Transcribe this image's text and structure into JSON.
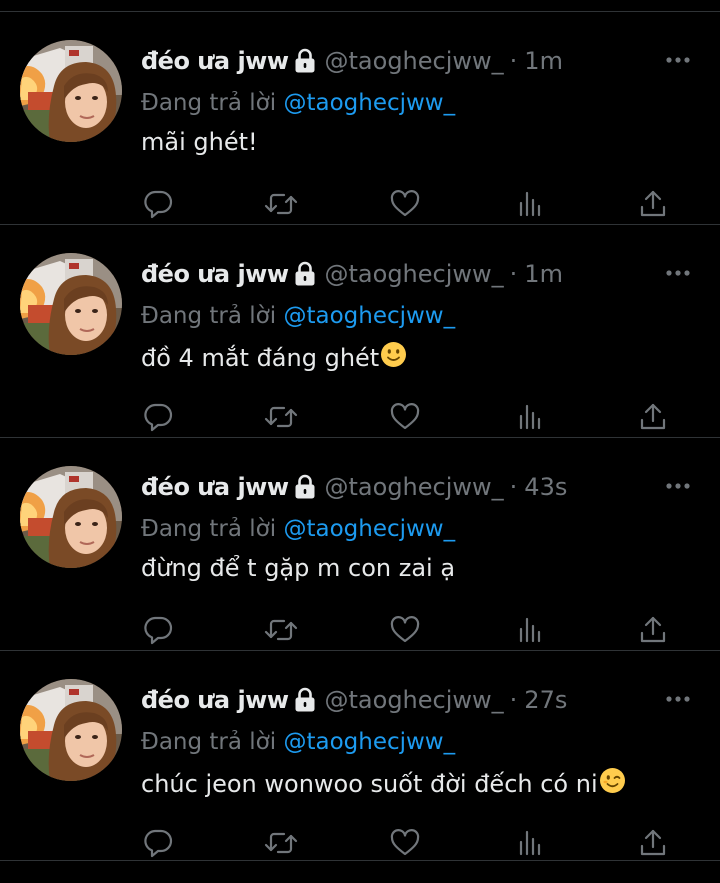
{
  "colors": {
    "background": "#000000",
    "text": "#e7e9ea",
    "muted": "#71767b",
    "link": "#1d9bf0",
    "divider": "#2f3336"
  },
  "tweets": [
    {
      "display_name": "đéo ưa jww",
      "handle": "@taoghecjww_",
      "dot": "·",
      "time": "1m",
      "reply_prefix": "Đang trả lời",
      "reply_to": "@taoghecjww_",
      "text": "mãi ghét!",
      "emoji": ""
    },
    {
      "display_name": "đéo ưa jww",
      "handle": "@taoghecjww_",
      "dot": "·",
      "time": "1m",
      "reply_prefix": "Đang trả lời",
      "reply_to": "@taoghecjww_",
      "text": "đồ 4 mắt đáng ghét",
      "emoji": "slightly-smiling-face-emoji"
    },
    {
      "display_name": "đéo ưa jww",
      "handle": "@taoghecjww_",
      "dot": "·",
      "time": "43s",
      "reply_prefix": "Đang trả lời",
      "reply_to": "@taoghecjww_",
      "text": "đừng để t gặp m con zai ạ",
      "emoji": ""
    },
    {
      "display_name": "đéo ưa jww",
      "handle": "@taoghecjww_",
      "dot": "·",
      "time": "27s",
      "reply_prefix": "Đang trả lời",
      "reply_to": "@taoghecjww_",
      "text": "chúc jeon wonwoo suốt đời đếch có ni",
      "emoji": "winking-face-emoji"
    }
  ],
  "icons": {
    "more": "more-horizontal-icon",
    "lock": "lock-icon",
    "reply": "reply-icon",
    "retweet": "retweet-icon",
    "like": "heart-icon",
    "views": "analytics-icon",
    "share": "share-icon"
  }
}
